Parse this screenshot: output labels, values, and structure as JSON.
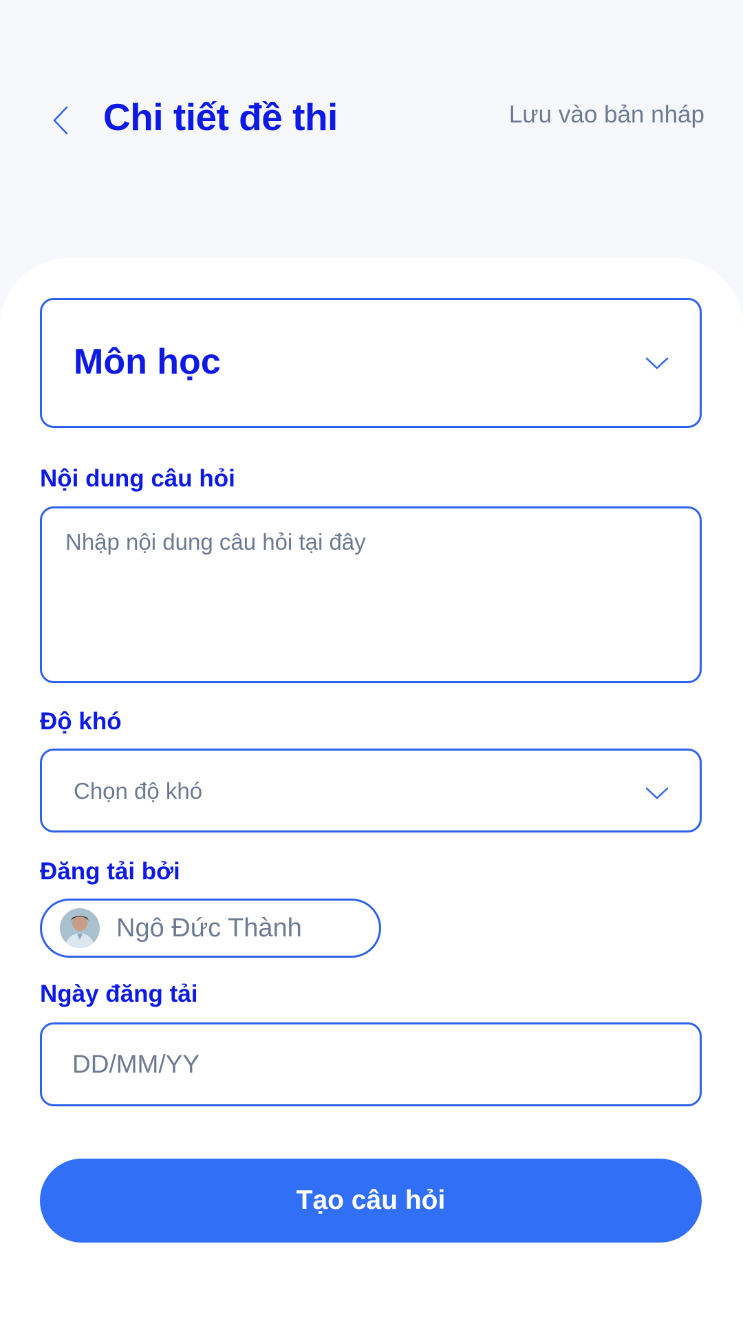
{
  "header": {
    "title": "Chi tiết đề thi",
    "save_draft_label": "Lưu vào bản nháp"
  },
  "form": {
    "subject": {
      "label": "Môn học"
    },
    "question_content": {
      "label": "Nội dung câu hỏi",
      "placeholder": "Nhập nội dung câu hỏi tại đây"
    },
    "difficulty": {
      "label": "Độ khó",
      "placeholder": "Chọn độ khó"
    },
    "uploaded_by": {
      "label": "Đăng tải bởi",
      "name": "Ngô Đức Thành"
    },
    "upload_date": {
      "label": "Ngày đăng tải",
      "placeholder": "DD/MM/YY"
    },
    "submit_label": "Tạo câu hỏi"
  },
  "icons": {
    "back": "chevron-left-icon",
    "dropdown": "chevron-down-icon"
  },
  "colors": {
    "title": "#0d1ae6",
    "border": "#2f62ea",
    "button": "#3170f6",
    "muted_text": "#6e7a91",
    "background": "#f7f8fc"
  }
}
